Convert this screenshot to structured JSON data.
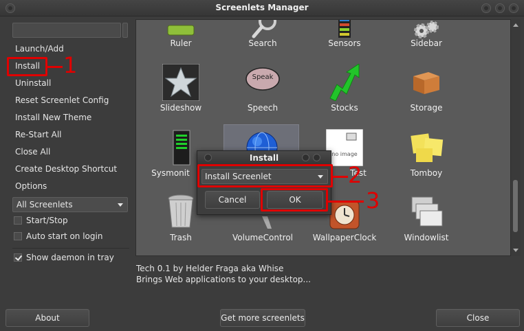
{
  "window": {
    "title": "Screenlets Manager"
  },
  "sidebar": {
    "items": [
      {
        "label": "Launch/Add"
      },
      {
        "label": "Install"
      },
      {
        "label": "Uninstall"
      },
      {
        "label": "Reset Screenlet Config"
      },
      {
        "label": "Install New Theme"
      },
      {
        "label": "Re-Start All"
      },
      {
        "label": "Close All"
      },
      {
        "label": "Create Desktop Shortcut"
      },
      {
        "label": "Options"
      }
    ],
    "filter_select": "All Screenlets",
    "checkboxes": [
      {
        "label": "Start/Stop",
        "checked": false
      },
      {
        "label": "Auto start on login",
        "checked": false
      },
      {
        "label": "Show daemon in tray",
        "checked": true
      }
    ]
  },
  "screenlets": [
    {
      "name": "Ruler",
      "icon": "ruler-icon"
    },
    {
      "name": "Search",
      "icon": "search-icon"
    },
    {
      "name": "Sensors",
      "icon": "sensors-icon"
    },
    {
      "name": "Sidebar",
      "icon": "gears-icon"
    },
    {
      "name": "Slideshow",
      "icon": "star-icon"
    },
    {
      "name": "Speech",
      "icon": "speech-bubble-icon",
      "icon_text": "Speak"
    },
    {
      "name": "Stocks",
      "icon": "stock-arrow-icon"
    },
    {
      "name": "Storage",
      "icon": "box-icon"
    },
    {
      "name": "Sysmonitor",
      "label_visible": "Sysmonit",
      "icon": "pc-tower-icon"
    },
    {
      "name": "Tech",
      "icon": "globe-icon",
      "selected": true
    },
    {
      "name": "Test",
      "label_visible": "Test",
      "icon": "no-image-icon",
      "icon_text": "no image"
    },
    {
      "name": "Tomboy",
      "icon": "sticky-notes-icon"
    },
    {
      "name": "Trash",
      "icon": "trash-icon"
    },
    {
      "name": "VolumeControl",
      "icon": "volume-icon"
    },
    {
      "name": "WallpaperClock",
      "icon": "clock-icon"
    },
    {
      "name": "Windowlist",
      "icon": "windows-icon"
    }
  ],
  "description": {
    "line1": "Tech 0.1 by Helder Fraga aka Whise",
    "line2": "Brings Web applications to your desktop..."
  },
  "footer": {
    "about_label": "About",
    "more_label": "Get more screenlets",
    "close_label": "Close"
  },
  "dialog": {
    "title": "Install",
    "select_value": "Install Screenlet",
    "cancel_label": "Cancel",
    "ok_label": "OK"
  },
  "annotations": {
    "n1": "1",
    "n2": "2",
    "n3": "3",
    "color": "#e00000"
  }
}
